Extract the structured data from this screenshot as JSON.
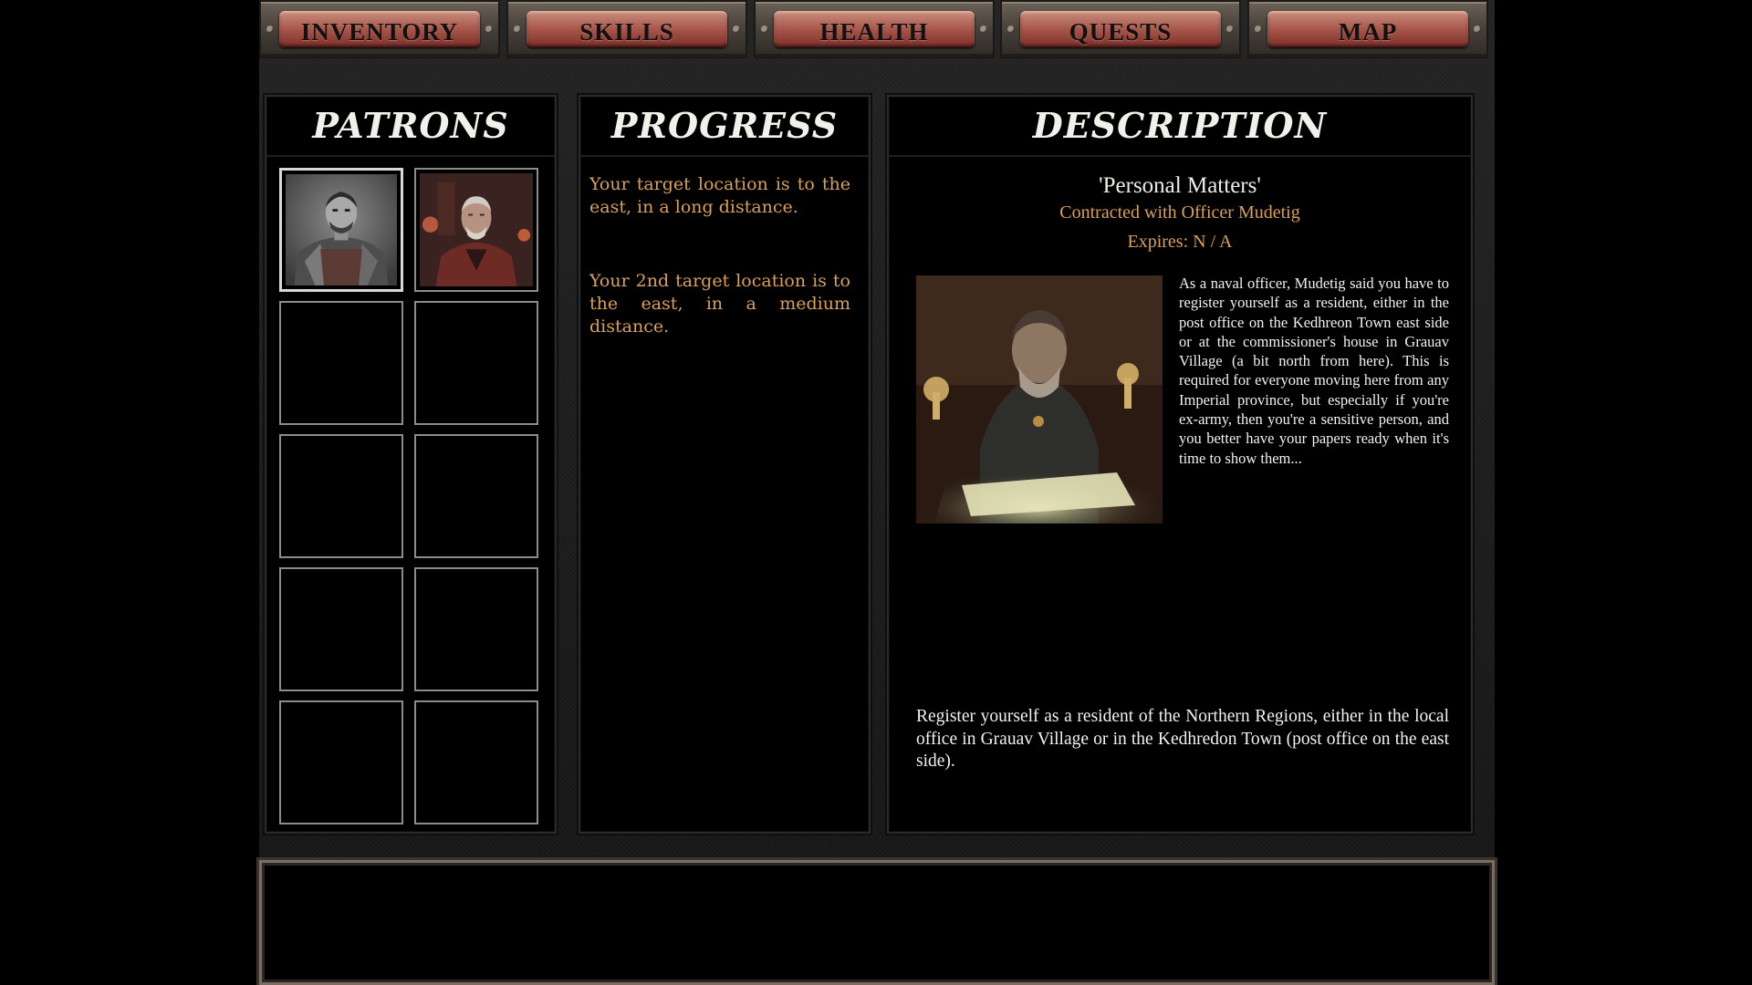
{
  "tabs": [
    {
      "label": "INVENTORY"
    },
    {
      "label": "SKILLS"
    },
    {
      "label": "HEALTH"
    },
    {
      "label": "QUESTS"
    },
    {
      "label": "MAP"
    }
  ],
  "patrons": {
    "title": "PATRONS",
    "slots": [
      {
        "portrait": "armored-soldier-portrait",
        "selected": true
      },
      {
        "portrait": "old-man-portrait",
        "selected": false
      },
      {},
      {},
      {},
      {},
      {},
      {},
      {},
      {}
    ]
  },
  "progress": {
    "title": "PROGRESS",
    "entries": [
      "Your target location is to the east, in a long distance.",
      "Your 2nd target location is to the east, in a medium distance."
    ]
  },
  "description": {
    "title": "DESCRIPTION",
    "quest_name": "'Personal Matters'",
    "contract": "Contracted with Officer Mudetig",
    "expires": "Expires: N / A",
    "image": "officer-at-desk-portrait",
    "body": "As a naval officer, Mudetig said you have to register yourself as a resident, either in the post office on the Kedhreon Town east side or at the commissioner's house in Grauav Village (a bit north from here). This is required for everyone moving here from any Imperial province, but especially if you're ex-army, then you're a sensitive person, and you better have your papers ready when it's time to show them...",
    "task": "Register yourself as a resident of the Northern Regions, either in the local office in Grauav Village or in the Kedhredon Town (post office on the east side)."
  },
  "message_box": {
    "text": ""
  },
  "colors": {
    "accent_text": "#d9a05a",
    "tab_plate": "#a8564a",
    "panel_bg": "#000000"
  }
}
